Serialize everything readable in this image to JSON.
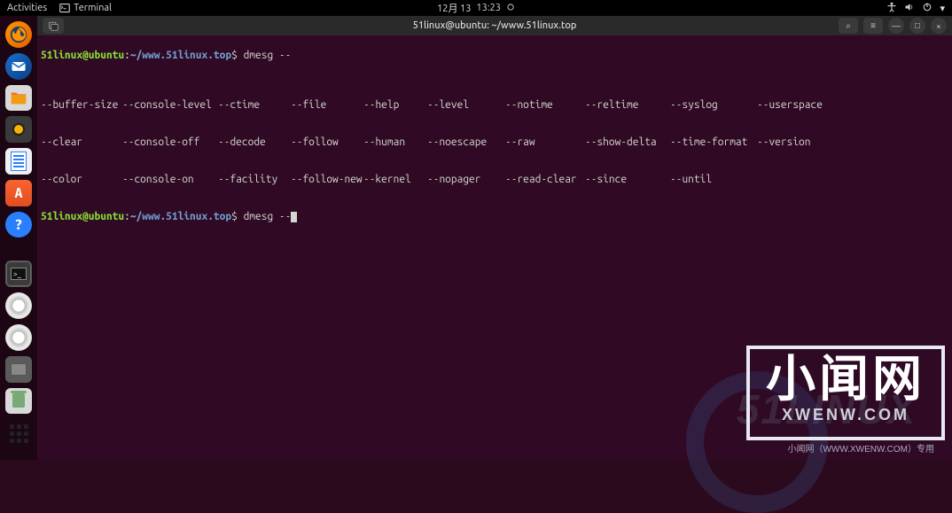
{
  "topbar": {
    "activities": "Activities",
    "terminal_label": "Terminal",
    "date": "12月 13",
    "time": "13:23"
  },
  "titlebar": {
    "title": "51linux@ubuntu: ~/www.51linux.top",
    "new_tab_symbol": "▫",
    "search_symbol": "⌕",
    "menu_symbol": "≡",
    "min_symbol": "—",
    "max_symbol": "□",
    "close_symbol": "×"
  },
  "prompt": {
    "user": "51linux",
    "at": "@",
    "host": "ubuntu",
    "colon": ":",
    "path": "~/www.51linux.top",
    "dollar": "$",
    "command": "dmesg --"
  },
  "completions": [
    [
      "--buffer-size",
      "--console-level",
      "--ctime",
      "--file",
      "--help",
      "--level",
      "--notime",
      "--reltime",
      "--syslog",
      "--userspace"
    ],
    [
      "--clear",
      "--console-off",
      "--decode",
      "--follow",
      "--human",
      "--noescape",
      "--raw",
      "--show-delta",
      "--time-format",
      "--version"
    ],
    [
      "--color",
      "--console-on",
      "--facility",
      "--follow-new",
      "--kernel",
      "--nopager",
      "--read-clear",
      "--since",
      "--until",
      ""
    ]
  ],
  "dock": [
    {
      "name": "firefox",
      "label": "Firefox"
    },
    {
      "name": "thunderbird",
      "label": "Thunderbird"
    },
    {
      "name": "files",
      "label": "Files"
    },
    {
      "name": "rhythmbox",
      "label": "Rhythmbox"
    },
    {
      "name": "libreoffice",
      "label": "LibreOffice Writer"
    },
    {
      "name": "software",
      "label": "Ubuntu Software"
    },
    {
      "name": "help",
      "label": "Help"
    },
    {
      "name": "terminal",
      "label": "Terminal"
    },
    {
      "name": "disc1",
      "label": "CD/DVD"
    },
    {
      "name": "disc2",
      "label": "CD/DVD"
    },
    {
      "name": "disk",
      "label": "Disk"
    },
    {
      "name": "trash",
      "label": "Trash"
    },
    {
      "name": "show-apps",
      "label": "Show Applications"
    }
  ],
  "watermark": {
    "big": "小闻网",
    "sub": "XWENW.COM",
    "footer": "小闻网（WWW.XWENW.COM）专用",
    "bg_text": "51LINUX"
  }
}
